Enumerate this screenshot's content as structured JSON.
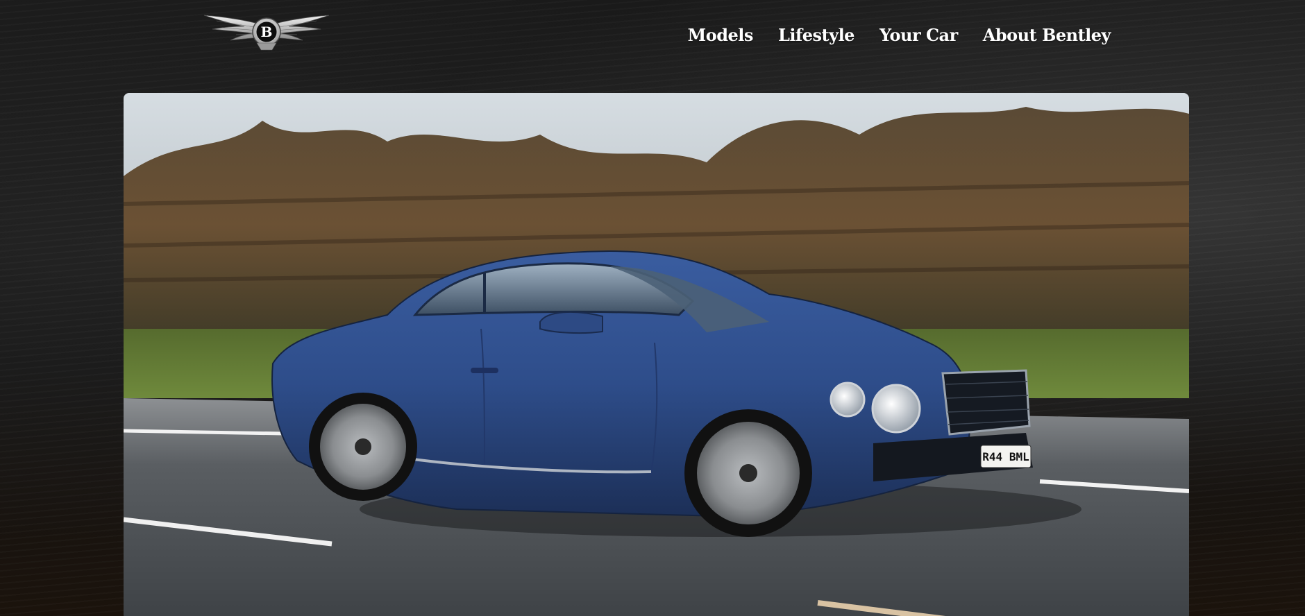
{
  "brand": {
    "logo_icon": "bentley-winged-b-logo",
    "logo_letter": "B"
  },
  "nav": {
    "items": [
      {
        "label": "Models"
      },
      {
        "label": "Lifestyle"
      },
      {
        "label": "Your Car"
      },
      {
        "label": "About Bentley"
      }
    ]
  },
  "hero": {
    "image_icon": "bentley-coupe-photo",
    "license_plate": "R44 BML",
    "colors": {
      "car_body": "#2f4f8c",
      "sky": "#cfd6dc",
      "grass": "#5f7a35",
      "road": "#4e5256"
    }
  }
}
